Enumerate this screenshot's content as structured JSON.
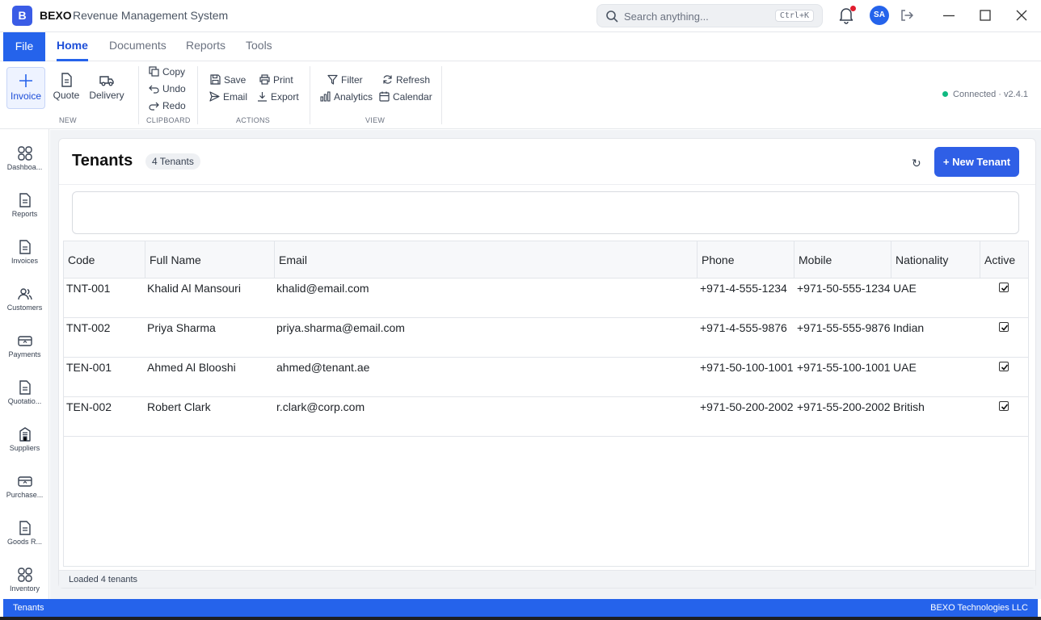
{
  "app": {
    "logo_letter": "B",
    "brand": "BEXO",
    "subtitle": "Revenue Management System",
    "search_placeholder": "Search anything...",
    "search_shortcut": "Ctrl+K",
    "avatar_initials": "SA"
  },
  "tabs": {
    "file": "File",
    "home": "Home",
    "documents": "Documents",
    "reports": "Reports",
    "tools": "Tools"
  },
  "ribbon": {
    "new": {
      "label": "NEW",
      "invoice": "Invoice",
      "quote": "Quote",
      "delivery": "Delivery"
    },
    "clipboard": {
      "label": "CLIPBOARD",
      "copy": "Copy",
      "undo": "Undo",
      "redo": "Redo"
    },
    "actions": {
      "label": "ACTIONS",
      "save": "Save",
      "print": "Print",
      "email": "Email",
      "export": "Export"
    },
    "view": {
      "label": "VIEW",
      "filter": "Filter",
      "refresh": "Refresh",
      "analytics": "Analytics",
      "calendar": "Calendar"
    },
    "connection": "Connected",
    "version": "v2.4.1"
  },
  "nav": {
    "dashboard": "Dashboa...",
    "reports": "Reports",
    "invoices": "Invoices",
    "customers": "Customers",
    "payments": "Payments",
    "quotations": "Quotatio...",
    "suppliers": "Suppliers",
    "purchase": "Purchase...",
    "goods": "Goods R...",
    "inventory": "Inventory"
  },
  "page": {
    "title": "Tenants",
    "count_badge": "4 Tenants",
    "refresh_glyph": "↻",
    "new_button": "+ New Tenant",
    "status": "Loaded 4 tenants"
  },
  "table": {
    "columns": [
      "Code",
      "Full Name",
      "Email",
      "Phone",
      "Mobile",
      "Nationality",
      "Active"
    ],
    "rows": [
      {
        "code": "TNT-001",
        "name": "Khalid Al Mansouri",
        "email": "khalid@email.com",
        "phone": "+971-4-555-1234",
        "mobile": "+971-50-555-1234",
        "nationality": "UAE",
        "active": true
      },
      {
        "code": "TNT-002",
        "name": "Priya Sharma",
        "email": "priya.sharma@email.com",
        "phone": "+971-4-555-9876",
        "mobile": "+971-55-555-9876",
        "nationality": "Indian",
        "active": true
      },
      {
        "code": "TEN-001",
        "name": "Ahmed Al Blooshi",
        "email": "ahmed@tenant.ae",
        "phone": "+971-50-100-1001",
        "mobile": "+971-55-100-1001",
        "nationality": "UAE",
        "active": true
      },
      {
        "code": "TEN-002",
        "name": "Robert Clark",
        "email": "r.clark@corp.com",
        "phone": "+971-50-200-2002",
        "mobile": "+971-55-200-2002",
        "nationality": "British",
        "active": true
      }
    ]
  },
  "footer": {
    "left": "Tenants",
    "right": "BEXO Technologies LLC"
  },
  "colors": {
    "primary": "#2563eb",
    "connected": "#10b981",
    "notification": "#e11d2e"
  }
}
